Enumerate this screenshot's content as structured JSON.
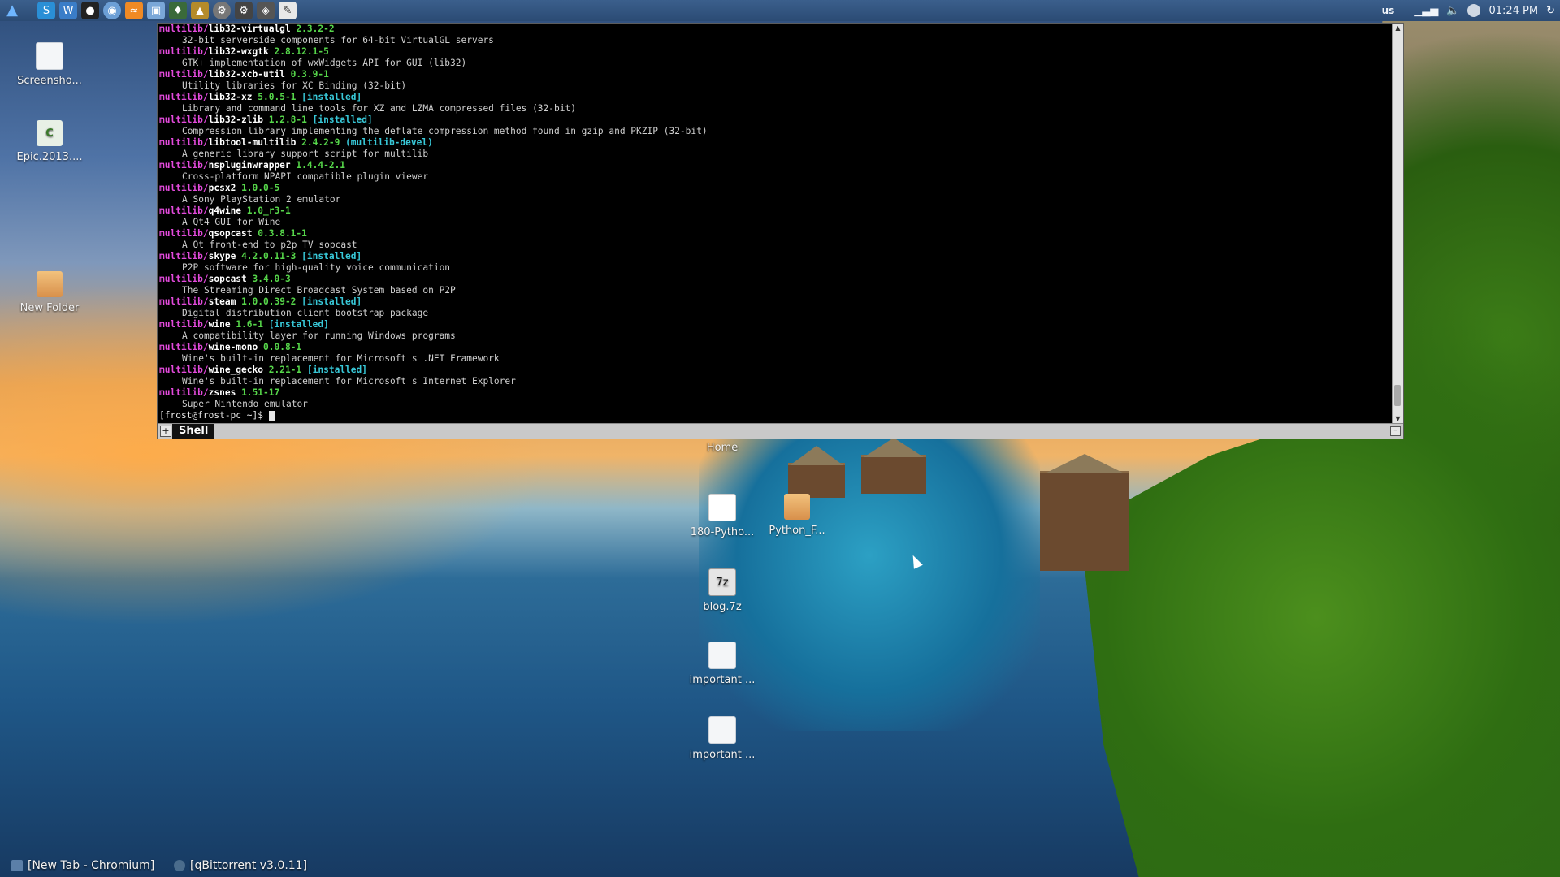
{
  "top_panel": {
    "launchers": [
      "arch-icon",
      "skype-icon",
      "writer-icon",
      "terminal-icon",
      "chromium-icon",
      "rss-icon",
      "screenshot-icon",
      "game-icon",
      "wine-icon",
      "settings-icon",
      "steam-icon",
      "python-icon",
      "file-icon"
    ],
    "keyboard_layout": "us",
    "clock": "01:24 PM"
  },
  "desktop_icons_left": [
    {
      "label": "Screensho...",
      "icon": "screenshot-file-icon"
    },
    {
      "label": "Epic.2013....",
      "icon": "epic-icon"
    },
    {
      "label": "New Folder",
      "icon": "folder-icon"
    }
  ],
  "desktop_icons_center": [
    {
      "label": "Home",
      "icon": "home-folder-icon"
    },
    {
      "label": "180-Pytho...",
      "icon": "document-icon"
    },
    {
      "label": "Python_F...",
      "icon": "folder-icon"
    },
    {
      "label": "blog.7z",
      "icon": "archive-icon"
    },
    {
      "label": "important ...",
      "icon": "image-file-icon"
    },
    {
      "label": "important ...",
      "icon": "image-file-icon"
    }
  ],
  "terminal": {
    "tab_label": "Shell",
    "prompt": "[frost@frost-pc ~]$ ",
    "lines": [
      {
        "repo": "multilib/",
        "pkg": "lib32-virtualgl",
        "ver": "2.3.2-2",
        "tag": ""
      },
      {
        "desc": "32-bit serverside components for 64-bit VirtualGL servers"
      },
      {
        "repo": "multilib/",
        "pkg": "lib32-wxgtk",
        "ver": "2.8.12.1-5",
        "tag": ""
      },
      {
        "desc": "GTK+ implementation of wxWidgets API for GUI (lib32)"
      },
      {
        "repo": "multilib/",
        "pkg": "lib32-xcb-util",
        "ver": "0.3.9-1",
        "tag": ""
      },
      {
        "desc": "Utility libraries for XC Binding (32-bit)"
      },
      {
        "repo": "multilib/",
        "pkg": "lib32-xz",
        "ver": "5.0.5-1",
        "tag": "[installed]"
      },
      {
        "desc": "Library and command line tools for XZ and LZMA compressed files (32-bit)"
      },
      {
        "repo": "multilib/",
        "pkg": "lib32-zlib",
        "ver": "1.2.8-1",
        "tag": "[installed]"
      },
      {
        "desc": "Compression library implementing the deflate compression method found in gzip and PKZIP (32-bit)"
      },
      {
        "repo": "multilib/",
        "pkg": "libtool-multilib",
        "ver": "2.4.2-9",
        "tag": "(multilib-devel)"
      },
      {
        "desc": "A generic library support script for multilib"
      },
      {
        "repo": "multilib/",
        "pkg": "nspluginwrapper",
        "ver": "1.4.4-2.1",
        "tag": ""
      },
      {
        "desc": "Cross-platform NPAPI compatible plugin viewer"
      },
      {
        "repo": "multilib/",
        "pkg": "pcsx2",
        "ver": "1.0.0-5",
        "tag": ""
      },
      {
        "desc": "A Sony PlayStation 2 emulator"
      },
      {
        "repo": "multilib/",
        "pkg": "q4wine",
        "ver": "1.0_r3-1",
        "tag": ""
      },
      {
        "desc": "A Qt4 GUI for Wine"
      },
      {
        "repo": "multilib/",
        "pkg": "qsopcast",
        "ver": "0.3.8.1-1",
        "tag": ""
      },
      {
        "desc": "A Qt front-end to p2p TV sopcast"
      },
      {
        "repo": "multilib/",
        "pkg": "skype",
        "ver": "4.2.0.11-3",
        "tag": "[installed]"
      },
      {
        "desc": "P2P software for high-quality voice communication"
      },
      {
        "repo": "multilib/",
        "pkg": "sopcast",
        "ver": "3.4.0-3",
        "tag": ""
      },
      {
        "desc": "The Streaming Direct Broadcast System based on P2P"
      },
      {
        "repo": "multilib/",
        "pkg": "steam",
        "ver": "1.0.0.39-2",
        "tag": "[installed]"
      },
      {
        "desc": "Digital distribution client bootstrap package"
      },
      {
        "repo": "multilib/",
        "pkg": "wine",
        "ver": "1.6-1",
        "tag": "[installed]"
      },
      {
        "desc": "A compatibility layer for running Windows programs"
      },
      {
        "repo": "multilib/",
        "pkg": "wine-mono",
        "ver": "0.0.8-1",
        "tag": ""
      },
      {
        "desc": "Wine's built-in replacement for Microsoft's .NET Framework"
      },
      {
        "repo": "multilib/",
        "pkg": "wine_gecko",
        "ver": "2.21-1",
        "tag": "[installed]"
      },
      {
        "desc": "Wine's built-in replacement for Microsoft's Internet Explorer"
      },
      {
        "repo": "multilib/",
        "pkg": "zsnes",
        "ver": "1.51-17",
        "tag": ""
      },
      {
        "desc": "Super Nintendo emulator"
      }
    ]
  },
  "taskbar": {
    "tasks": [
      {
        "label": "[New Tab - Chromium]",
        "icon": "chromium-task-icon"
      },
      {
        "label": "[qBittorrent v3.0.11]",
        "icon": "qbittorrent-task-icon"
      }
    ]
  },
  "colors": {
    "repo": "#e34adc",
    "version": "#56d64a",
    "tag": "#38c8d8",
    "panel": "#2b4b74"
  }
}
